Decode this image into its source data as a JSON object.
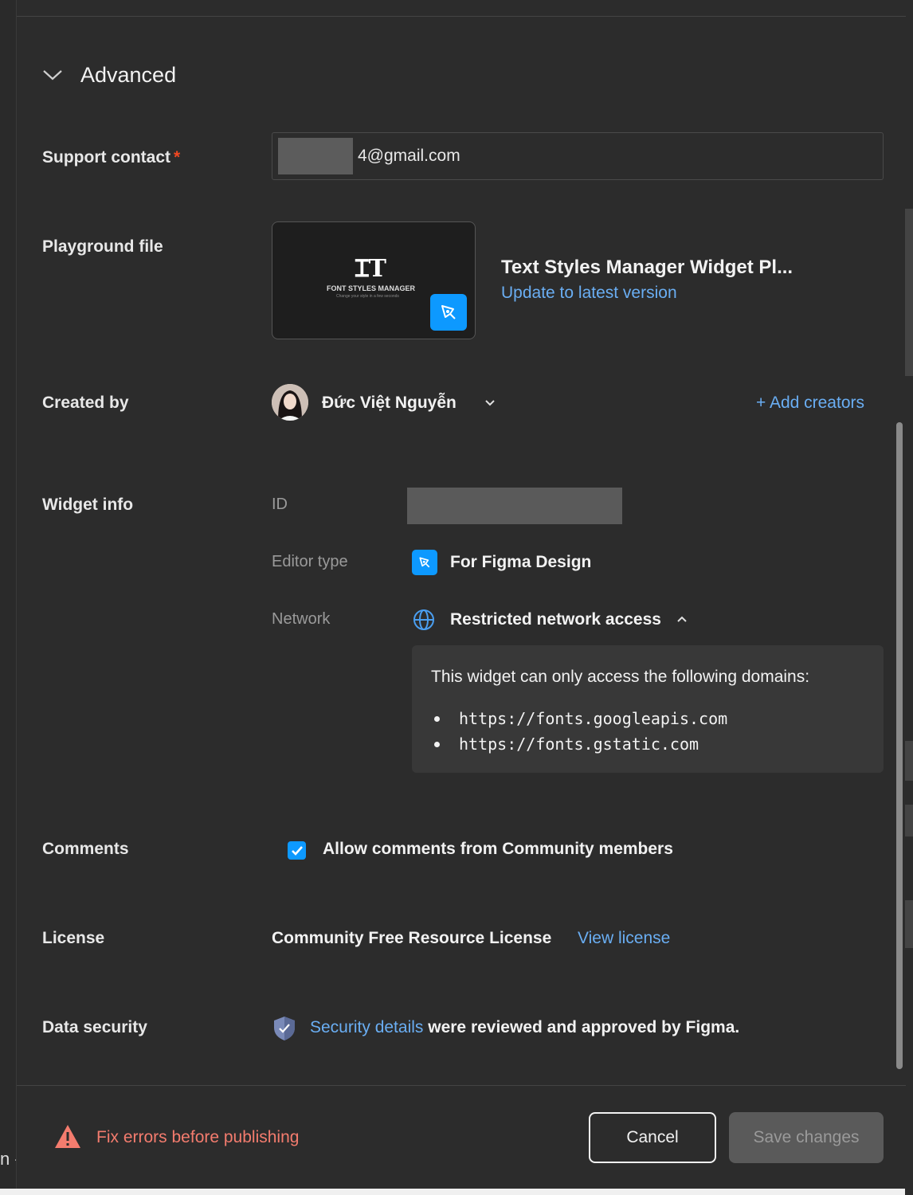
{
  "section": {
    "title": "Advanced",
    "toggle_icon": "chevron-down-icon"
  },
  "support_contact": {
    "label": "Support contact",
    "required_mark": "*",
    "email_suffix": "4@gmail.com"
  },
  "playground_file": {
    "label": "Playground file",
    "thumbnail_logo": "ꞮT",
    "thumbnail_caption": "FONT STYLES MANAGER",
    "thumbnail_subcaption": "Change your style in a few seconds",
    "title": "Text Styles Manager Widget Pl...",
    "update_link": "Update to latest version"
  },
  "created_by": {
    "label": "Created by",
    "creator_name": "Đức Việt Nguyễn",
    "add_link": "+ Add creators"
  },
  "widget_info": {
    "label": "Widget info",
    "id_key": "ID",
    "editor_key": "Editor type",
    "editor_value": "For Figma Design",
    "network_key": "Network",
    "network_value": "Restricted network access",
    "domains_intro": "This widget can only access the following domains:",
    "domains": [
      "https://fonts.googleapis.com",
      "https://fonts.gstatic.com"
    ]
  },
  "comments": {
    "label": "Comments",
    "checkbox_label": "Allow comments from Community members",
    "checked": true
  },
  "license": {
    "label": "License",
    "value": "Community Free Resource License",
    "link": "View license"
  },
  "data_security": {
    "label": "Data security",
    "link": "Security details",
    "text": " were reviewed and approved by Figma."
  },
  "footer": {
    "warning": "Fix errors before publishing",
    "cancel": "Cancel",
    "save": "Save changes"
  },
  "colors": {
    "background": "#2c2c2c",
    "accent": "#0d99ff",
    "link": "#6aaef3",
    "error": "#f47c6e"
  }
}
